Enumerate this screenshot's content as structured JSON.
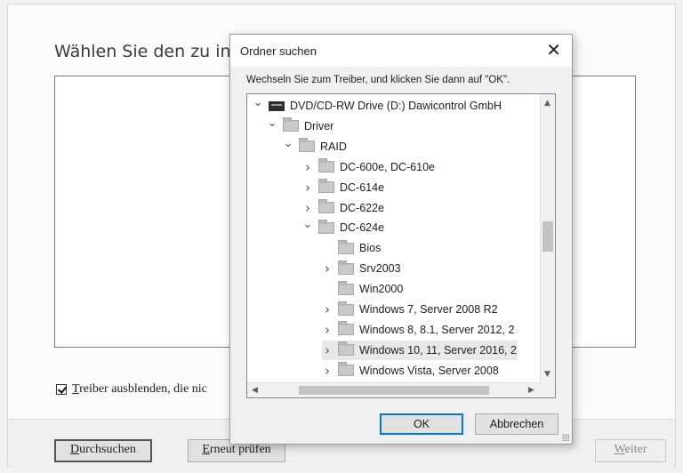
{
  "wizard": {
    "heading": "Wählen Sie den zu insta",
    "hide_checkbox_label_mnemonic": "T",
    "hide_checkbox_label_rest": "reiber ausblenden, die nic",
    "hide_checked": true,
    "browse_mnemonic": "D",
    "browse_rest": "urchsuchen",
    "recheck_mnemonic": "E",
    "recheck_rest": "rneut prüfen",
    "next_mnemonic": "W",
    "next_rest": "eiter"
  },
  "dialog": {
    "title": "Ordner suchen",
    "close": "✕",
    "instruction": "Wechseln Sie zum Treiber, und klicken Sie dann auf \"OK\".",
    "ok": "OK",
    "cancel": "Abbrechen",
    "tree": [
      {
        "label": "DVD/CD-RW Drive (D:) Dawicontrol GmbH",
        "chevron": "expanded",
        "icon": "drive-icon"
      },
      {
        "label": "Driver",
        "chevron": "expanded",
        "icon": "folder-icon"
      },
      {
        "label": "RAID",
        "chevron": "expanded",
        "icon": "folder-icon"
      },
      {
        "label": "DC-600e, DC-610e",
        "chevron": "collapsed",
        "icon": "folder-icon"
      },
      {
        "label": "DC-614e",
        "chevron": "collapsed",
        "icon": "folder-icon"
      },
      {
        "label": "DC-622e",
        "chevron": "collapsed",
        "icon": "folder-icon"
      },
      {
        "label": "DC-624e",
        "chevron": "expanded",
        "icon": "folder-icon"
      },
      {
        "label": "Bios",
        "chevron": "none",
        "icon": "folder-icon"
      },
      {
        "label": "Srv2003",
        "chevron": "collapsed",
        "icon": "folder-icon"
      },
      {
        "label": "Win2000",
        "chevron": "none",
        "icon": "folder-icon"
      },
      {
        "label": "Windows 7, Server 2008 R2",
        "chevron": "collapsed",
        "icon": "folder-icon"
      },
      {
        "label": "Windows 8, 8.1, Server 2012, 2",
        "chevron": "collapsed",
        "icon": "folder-icon"
      },
      {
        "label": "Windows 10, 11, Server 2016, 2",
        "chevron": "collapsed",
        "icon": "folder-icon",
        "selected": true
      },
      {
        "label": "Windows Vista, Server 2008",
        "chevron": "collapsed",
        "icon": "folder-icon"
      }
    ]
  },
  "colors": {
    "dialog_bg": "#f0f0f0",
    "default_button_border": "#0078d7",
    "selected_row": "#e8e8e8"
  }
}
